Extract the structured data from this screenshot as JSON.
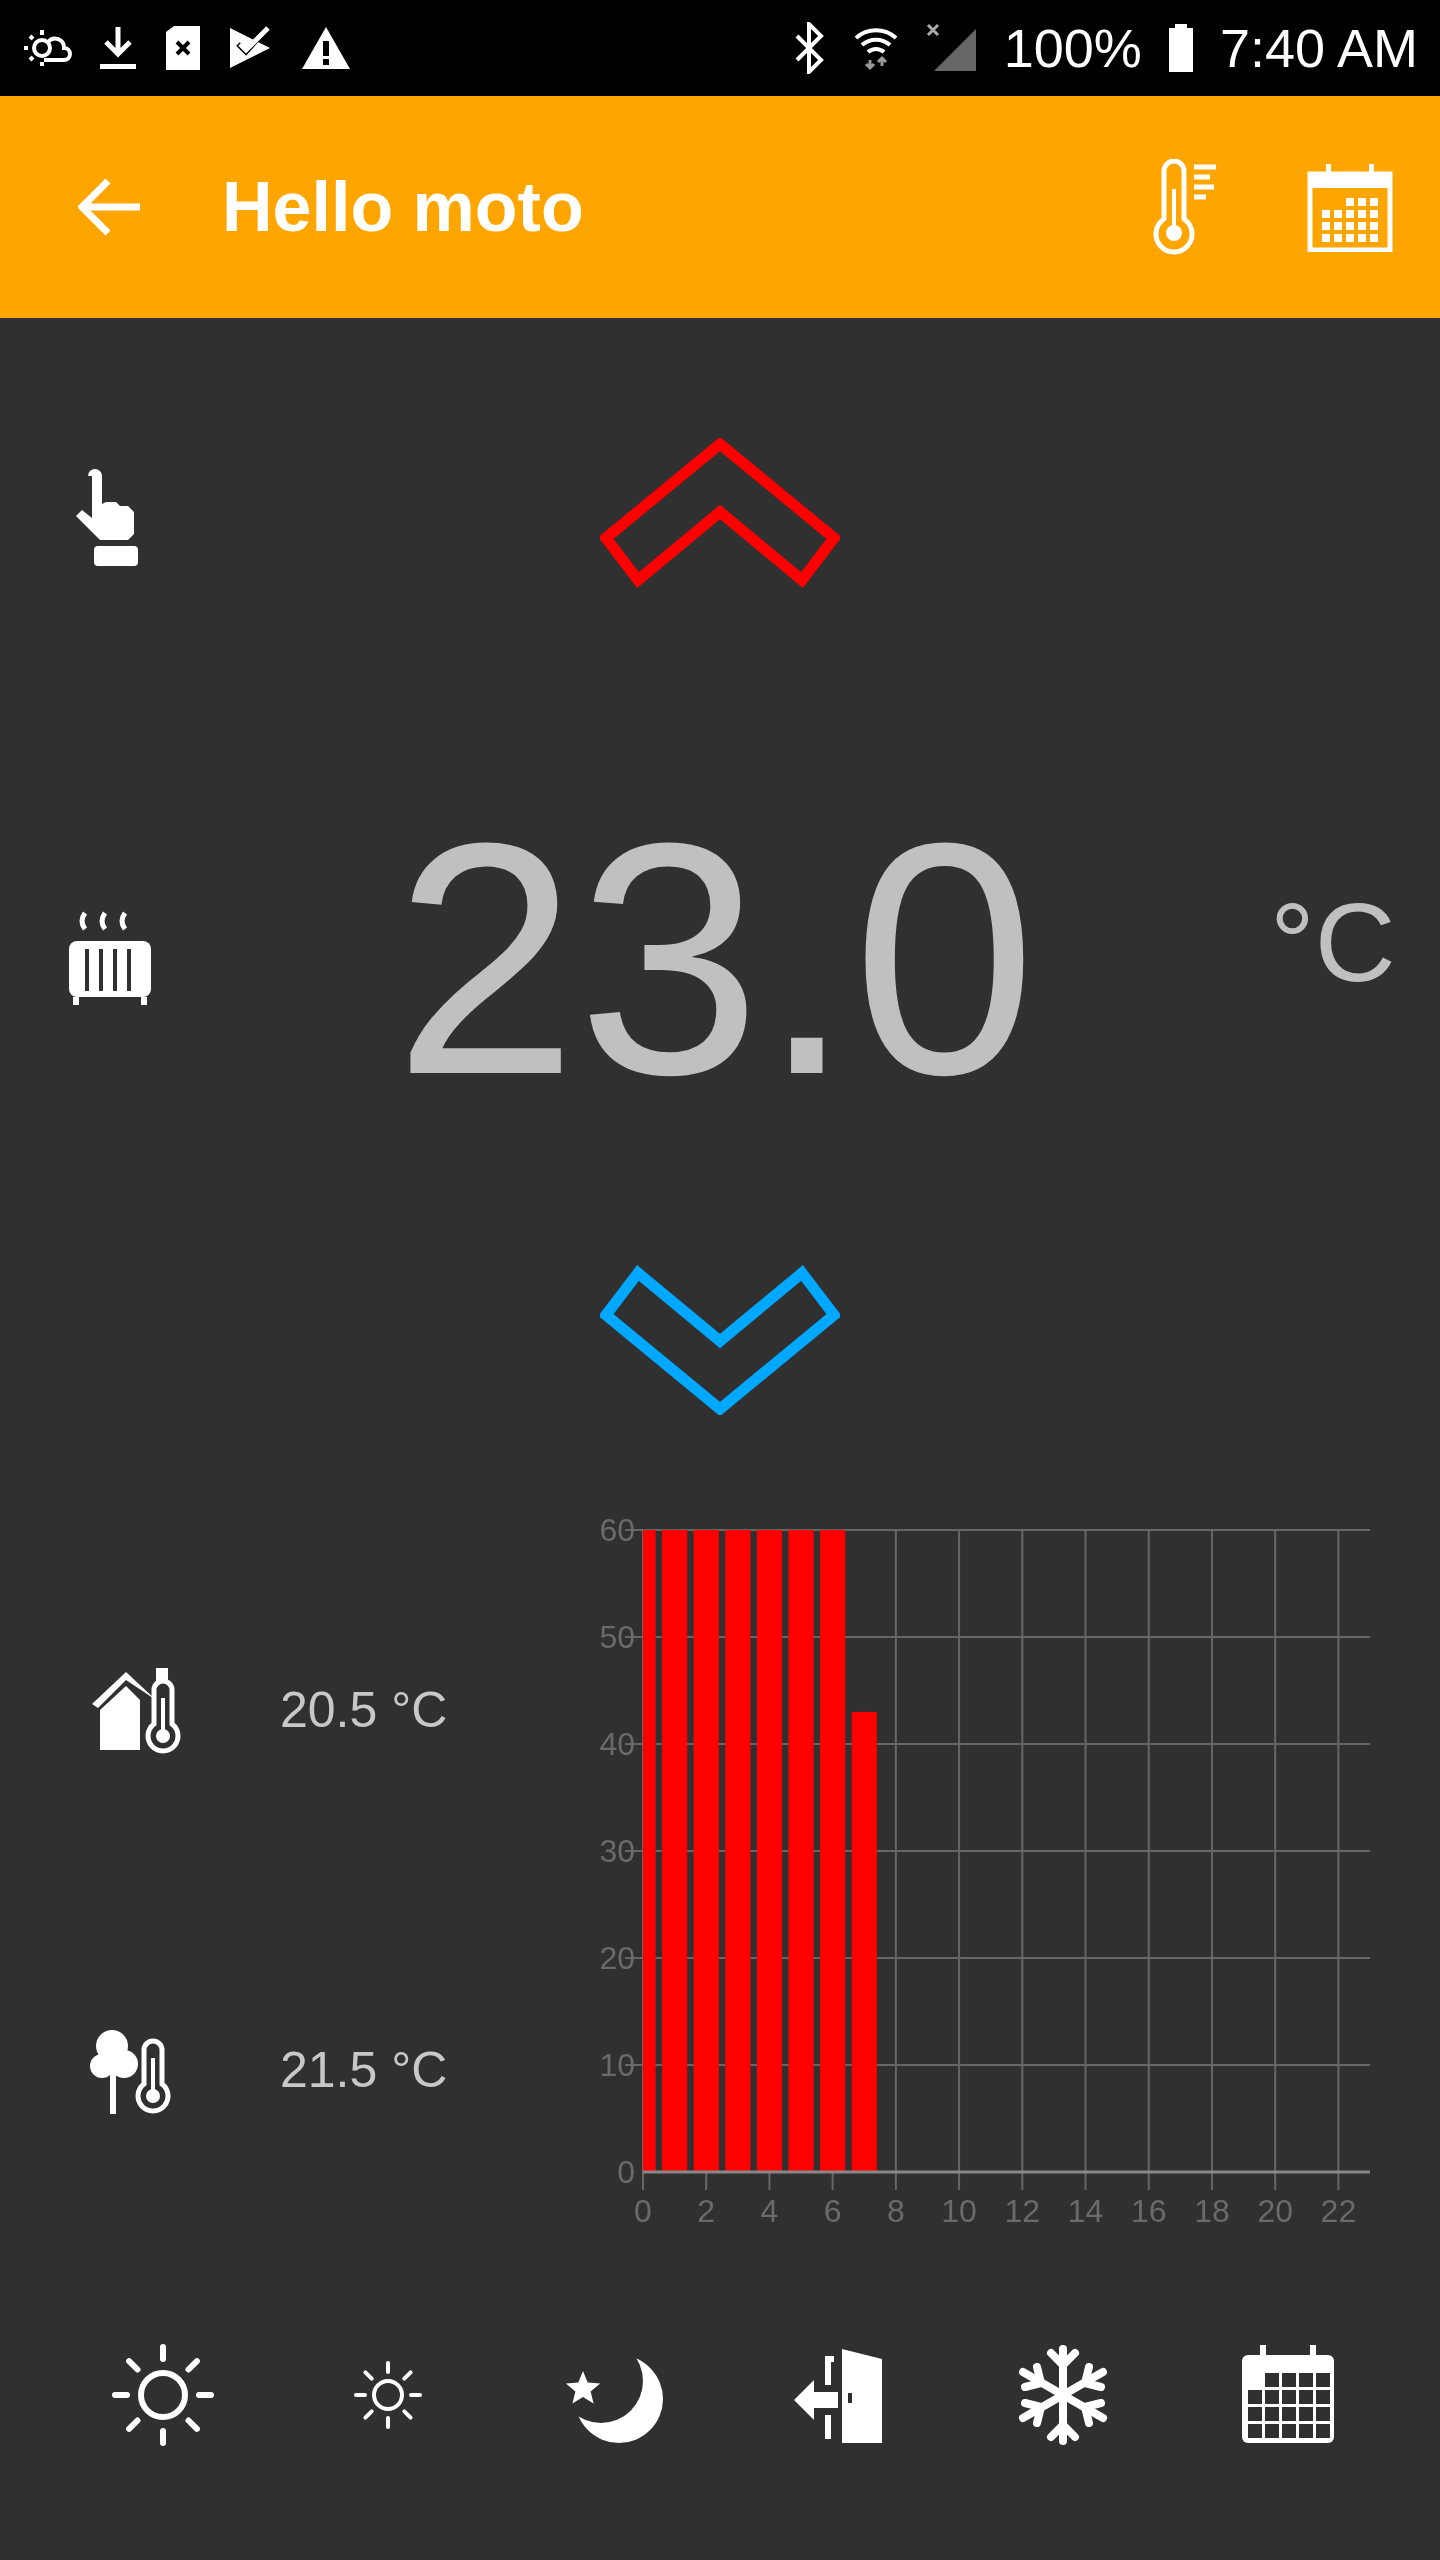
{
  "status_bar": {
    "battery": "100%",
    "time": "7:40 AM"
  },
  "toolbar": {
    "title": "Hello moto"
  },
  "setpoint": {
    "value": "23.0",
    "unit": "°C"
  },
  "sensors": [
    {
      "kind": "indoor",
      "reading": "20.5 °C"
    },
    {
      "kind": "outdoor",
      "reading": "21.5 °C"
    }
  ],
  "chart": {
    "chart_data": {
      "type": "bar",
      "x": [
        0,
        1,
        2,
        3,
        4,
        5,
        6,
        7
      ],
      "series": [
        {
          "color": "#ff0000",
          "values": [
            60,
            60,
            60,
            60,
            60,
            60,
            60,
            43
          ]
        }
      ],
      "xlim": [
        0,
        23
      ],
      "ylim": [
        0,
        60
      ],
      "xticks": [
        0,
        2,
        4,
        6,
        8,
        10,
        12,
        14,
        16,
        18,
        20,
        22
      ],
      "yticks": [
        0,
        10,
        20,
        30,
        40,
        50,
        60
      ],
      "grid": true
    }
  }
}
